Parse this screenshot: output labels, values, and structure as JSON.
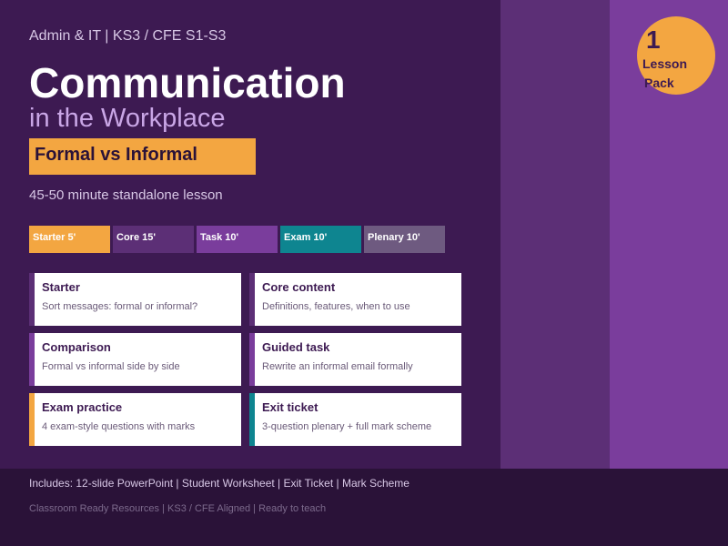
{
  "colors": {
    "background": "#3d1a52",
    "panel_mid": "#5c2f76",
    "panel_right": "#7a3d9c",
    "accent_orange": "#f3a641",
    "footer": "#2a1238",
    "teal": "#0e8590",
    "grey_purple": "#6e5a80"
  },
  "badge": {
    "number": "1",
    "line1": "Lesson",
    "line2": "Pack"
  },
  "header": {
    "breadcrumb": "Admin & IT  |  KS3 / CFE S1-S3",
    "title": "Communication",
    "subtitle": "in the Workplace",
    "topic": "Formal vs Informal",
    "duration": "45-50 minute standalone lesson"
  },
  "timeline": [
    {
      "label": "Starter 5'",
      "color": "#f3a641"
    },
    {
      "label": "Core 15'",
      "color": "#5c2f76"
    },
    {
      "label": "Task 10'",
      "color": "#7a3d9c"
    },
    {
      "label": "Exam 10'",
      "color": "#0e8590"
    },
    {
      "label": "Plenary 10'",
      "color": "#6e5a80"
    }
  ],
  "cards": [
    {
      "title": "Starter",
      "desc": "Sort messages: formal or informal?",
      "bar_color": "#5c2f76"
    },
    {
      "title": "Core content",
      "desc": "Definitions, features, when to use",
      "bar_color": "#5c2f76"
    },
    {
      "title": "Comparison",
      "desc": "Formal vs informal side by side",
      "bar_color": "#7a3d9c"
    },
    {
      "title": "Guided task",
      "desc": "Rewrite an informal email formally",
      "bar_color": "#7a3d9c"
    },
    {
      "title": "Exam practice",
      "desc": "4 exam-style questions with marks",
      "bar_color": "#f3a641"
    },
    {
      "title": "Exit ticket",
      "desc": "3-question plenary + full mark scheme",
      "bar_color": "#0e8590"
    }
  ],
  "footer": {
    "includes": "Includes: 12-slide PowerPoint  |  Student Worksheet  |  Exit Ticket  |  Mark Scheme",
    "tagline": "Classroom Ready Resources  |  KS3 / CFE Aligned  |  Ready to teach"
  }
}
